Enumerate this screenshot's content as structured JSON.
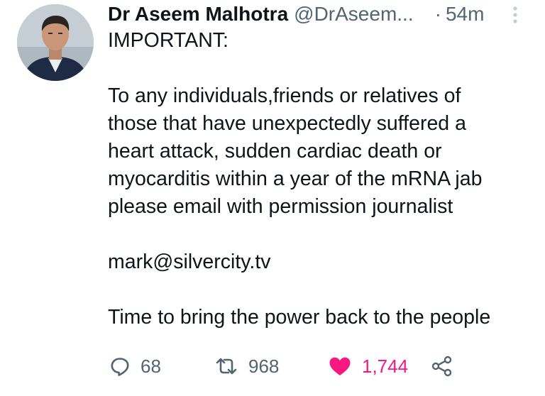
{
  "tweet": {
    "author": {
      "display_name": "Dr Aseem Malhotra",
      "handle": "@DrAseem...",
      "avatar_icon": "profile-photo"
    },
    "separator": "·",
    "time": "54m",
    "more_icon": "more-vertical-icon",
    "text": {
      "heading": "IMPORTANT:",
      "paragraph": "To any individuals,friends or relatives of\nthose that have unexpectedly suffered a\nheart attack, sudden cardiac death or\nmyocarditis within a year of the mRNA jab\nplease email with permission journalist",
      "email": "mark@silvercity.tv",
      "closing": "Time to bring the power back to the people"
    },
    "actions": {
      "reply": {
        "icon": "reply-icon",
        "count": "68"
      },
      "retweet": {
        "icon": "retweet-icon",
        "count": "968"
      },
      "like": {
        "icon": "heart-icon",
        "count": "1,744",
        "liked": true
      },
      "share": {
        "icon": "share-icon"
      }
    },
    "colors": {
      "text": "#0f1419",
      "secondary": "#536471",
      "like": "#f91880"
    }
  }
}
